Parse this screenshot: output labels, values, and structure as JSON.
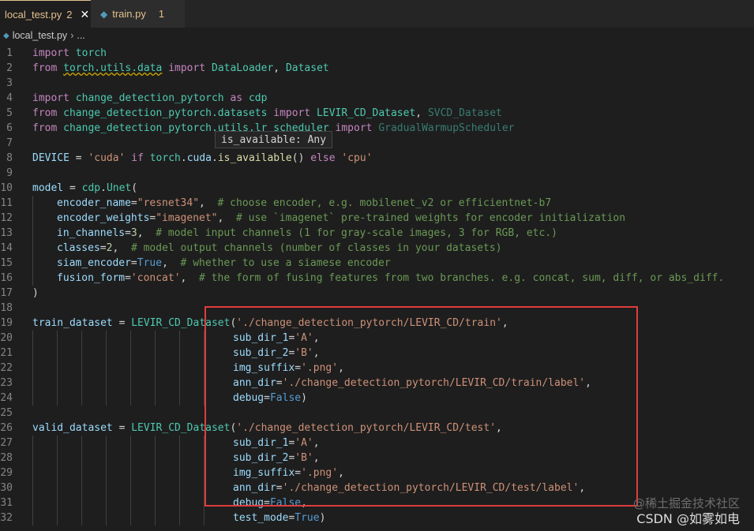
{
  "tabs": [
    {
      "label": "local_test.py",
      "count": "2",
      "active": true
    },
    {
      "label": "train.py",
      "count": "1",
      "active": false
    }
  ],
  "breadcrumb": {
    "file": "local_test.py",
    "more": "..."
  },
  "tooltip": {
    "name": "is_available",
    "type": ": Any"
  },
  "watermark": {
    "line1": "@稀土掘金技术社区",
    "line2": "CSDN @如雾如电"
  },
  "line_numbers": [
    "1",
    "2",
    "3",
    "4",
    "5",
    "6",
    "7",
    "8",
    "9",
    "10",
    "11",
    "12",
    "13",
    "14",
    "15",
    "16",
    "17",
    "18",
    "19",
    "20",
    "21",
    "22",
    "23",
    "24",
    "25",
    "26",
    "27",
    "28",
    "29",
    "30",
    "31",
    "32"
  ],
  "code": {
    "l1": [
      "import",
      " ",
      "torch"
    ],
    "l2": [
      "from",
      " ",
      "torch.utils.data",
      " ",
      "import",
      " ",
      "DataLoader",
      ", ",
      "Dataset"
    ],
    "l4": [
      "import",
      " ",
      "change_detection_pytorch",
      " ",
      "as",
      " ",
      "cdp"
    ],
    "l5": [
      "from",
      " ",
      "change_detection_pytorch.datasets",
      " ",
      "import",
      " ",
      "LEVIR_CD_Dataset",
      ", ",
      "SVCD_Dataset"
    ],
    "l6": [
      "from",
      " ",
      "change_detection_pytorch.utils.lr_scheduler",
      " ",
      "import",
      " ",
      "GradualWarmupScheduler"
    ],
    "l8": [
      "DEVICE",
      " = ",
      "'cuda'",
      " ",
      "if",
      " ",
      "torch",
      ".",
      "cuda",
      ".",
      "is_available",
      "() ",
      "else",
      " ",
      "'cpu'"
    ],
    "l10": [
      "model",
      " = ",
      "cdp",
      ".",
      "Unet",
      "("
    ],
    "l11": [
      "encoder_name",
      "=",
      "\"resnet34\"",
      ",  ",
      "# choose encoder, e.g. mobilenet_v2 or efficientnet-b7"
    ],
    "l12": [
      "encoder_weights",
      "=",
      "\"imagenet\"",
      ",  ",
      "# use `imagenet` pre-trained weights for encoder initialization"
    ],
    "l13": [
      "in_channels",
      "=",
      "3",
      ",  ",
      "# model input channels (1 for gray-scale images, 3 for RGB, etc.)"
    ],
    "l14": [
      "classes",
      "=",
      "2",
      ",  ",
      "# model output channels (number of classes in your datasets)"
    ],
    "l15": [
      "siam_encoder",
      "=",
      "True",
      ",  ",
      "# whether to use a siamese encoder"
    ],
    "l16": [
      "fusion_form",
      "=",
      "'concat'",
      ",  ",
      "# the form of fusing features from two branches. e.g. concat, sum, diff, or abs_diff."
    ],
    "l17": [
      ")"
    ],
    "l19": [
      "train_dataset",
      " = ",
      "LEVIR_CD_Dataset",
      "(",
      "'./change_detection_pytorch/LEVIR_CD/train'",
      ","
    ],
    "l20": [
      "sub_dir_1",
      "=",
      "'A'",
      ","
    ],
    "l21": [
      "sub_dir_2",
      "=",
      "'B'",
      ","
    ],
    "l22": [
      "img_suffix",
      "=",
      "'.png'",
      ","
    ],
    "l23": [
      "ann_dir",
      "=",
      "'./change_detection_pytorch/LEVIR_CD/train/label'",
      ","
    ],
    "l24": [
      "debug",
      "=",
      "False",
      ")"
    ],
    "l26": [
      "valid_dataset",
      " = ",
      "LEVIR_CD_Dataset",
      "(",
      "'./change_detection_pytorch/LEVIR_CD/test'",
      ","
    ],
    "l27": [
      "sub_dir_1",
      "=",
      "'A'",
      ","
    ],
    "l28": [
      "sub_dir_2",
      "=",
      "'B'",
      ","
    ],
    "l29": [
      "img_suffix",
      "=",
      "'.png'",
      ","
    ],
    "l30": [
      "ann_dir",
      "=",
      "'./change_detection_pytorch/LEVIR_CD/test/label'",
      ","
    ],
    "l31": [
      "debug",
      "=",
      "False",
      ","
    ],
    "l32": [
      "test_mode",
      "=",
      "True",
      ")"
    ]
  },
  "colors": {
    "accent_box": "#e03c3c",
    "modified_tab": "#e2c08d",
    "keyword": "#569cd6",
    "string": "#ce9178",
    "comment": "#6a9955"
  }
}
